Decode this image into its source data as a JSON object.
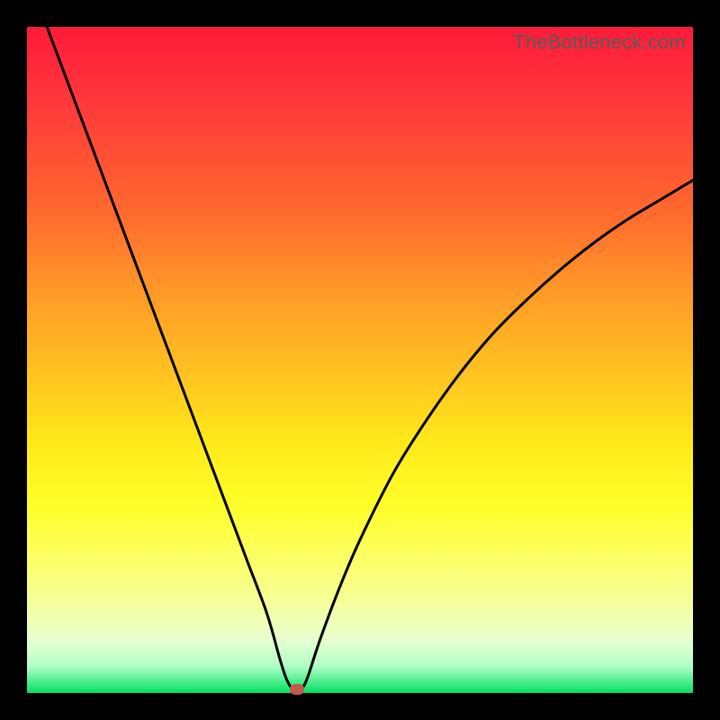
{
  "watermark": "TheBottleneck.com",
  "chart_data": {
    "type": "line",
    "title": "",
    "xlabel": "",
    "ylabel": "",
    "xlim": [
      0,
      100
    ],
    "ylim": [
      0,
      100
    ],
    "grid": false,
    "legend": false,
    "series": [
      {
        "name": "curve",
        "x": [
          3,
          6,
          9,
          12,
          15,
          18,
          21,
          24,
          27,
          30,
          33,
          36,
          38,
          39,
          40,
          41,
          42,
          44,
          47,
          50,
          55,
          60,
          65,
          70,
          75,
          80,
          85,
          90,
          95,
          100
        ],
        "y": [
          100,
          92,
          84,
          76,
          68,
          60,
          52,
          44,
          36,
          28,
          20,
          12,
          5,
          2,
          0.5,
          0.5,
          2,
          8,
          16,
          23,
          33,
          41,
          48,
          54,
          59,
          63.5,
          67.5,
          71,
          74,
          77
        ]
      }
    ],
    "marker": {
      "x": 40.5,
      "y": 0.5
    },
    "gradient_stops": [
      {
        "pos": 0,
        "color": "#ff1a3a"
      },
      {
        "pos": 12,
        "color": "#ff3a3a"
      },
      {
        "pos": 28,
        "color": "#ff6a2e"
      },
      {
        "pos": 40,
        "color": "#ff9a28"
      },
      {
        "pos": 52,
        "color": "#ffc220"
      },
      {
        "pos": 62,
        "color": "#ffe81a"
      },
      {
        "pos": 72,
        "color": "#ffff2a"
      },
      {
        "pos": 80,
        "color": "#fcff66"
      },
      {
        "pos": 87,
        "color": "#f4ffa0"
      },
      {
        "pos": 92,
        "color": "#e8ffd0"
      },
      {
        "pos": 96,
        "color": "#b0ffc8"
      },
      {
        "pos": 100,
        "color": "#00e060"
      }
    ]
  }
}
